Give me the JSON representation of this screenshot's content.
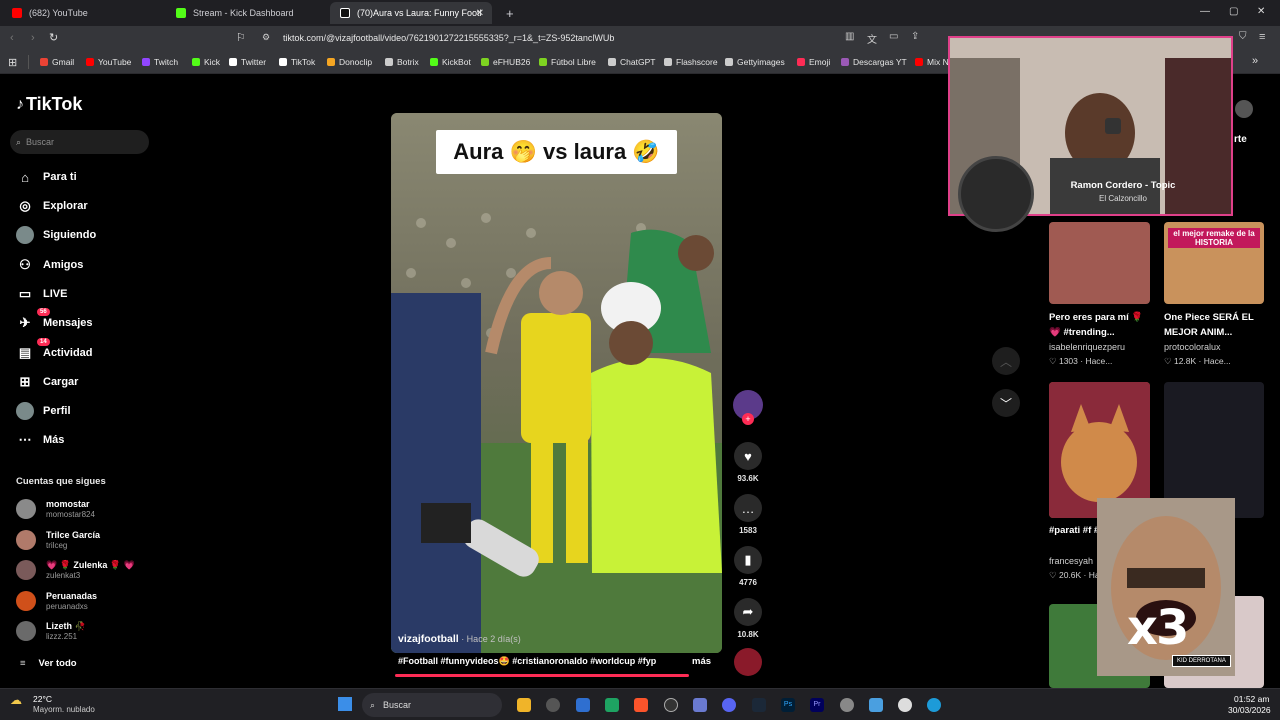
{
  "tabs": [
    {
      "label": "(682) YouTube",
      "color": "#ff0000"
    },
    {
      "label": "Stream - Kick Dashboard",
      "color": "#53fc18"
    },
    {
      "label": "(70)Aura vs Laura: Funny Footl",
      "color": "#ffffff"
    }
  ],
  "address": {
    "url": "tiktok.com/@vizajfootball/video/7621901272215555335?_r=1&_t=ZS-952tanclWUb"
  },
  "bookmarks": [
    {
      "label": "Gmail",
      "color": "#ea4335"
    },
    {
      "label": "YouTube",
      "color": "#ff0000"
    },
    {
      "label": "Twitch",
      "color": "#9146ff"
    },
    {
      "label": "Kick",
      "color": "#53fc18"
    },
    {
      "label": "Twitter",
      "color": "#ffffff"
    },
    {
      "label": "TikTok",
      "color": "#ffffff"
    },
    {
      "label": "Donoclip",
      "color": "#f5a623"
    },
    {
      "label": "Botrix",
      "color": "#cccccc"
    },
    {
      "label": "KickBot",
      "color": "#53fc18"
    },
    {
      "label": "eFHUB26",
      "color": "#7ed321"
    },
    {
      "label": "Fútbol Libre",
      "color": "#7ed321"
    },
    {
      "label": "ChatGPT",
      "color": "#cccccc"
    },
    {
      "label": "Flashscore",
      "color": "#cccccc"
    },
    {
      "label": "Gettyimages",
      "color": "#cccccc"
    },
    {
      "label": "Emoji",
      "color": "#fe2c55"
    },
    {
      "label": "Descargas YT",
      "color": "#9b59b6"
    },
    {
      "label": "Mix N",
      "color": "#ff0000"
    }
  ],
  "sidebar": {
    "logo": "TikTok",
    "search_placeholder": "Buscar",
    "nav": [
      {
        "label": "Para ti",
        "icon": "home-icon",
        "glyph": "⌂"
      },
      {
        "label": "Explorar",
        "icon": "compass-icon",
        "glyph": "◎"
      },
      {
        "label": "Siguiendo",
        "icon": "avatar-icon",
        "glyph": ""
      },
      {
        "label": "Amigos",
        "icon": "friends-icon",
        "glyph": "⚇"
      },
      {
        "label": "LIVE",
        "icon": "live-icon",
        "glyph": "▭"
      },
      {
        "label": "Mensajes",
        "icon": "messages-icon",
        "glyph": "✈",
        "badge": "56"
      },
      {
        "label": "Actividad",
        "icon": "activity-icon",
        "glyph": "▤",
        "badge": "14"
      },
      {
        "label": "Cargar",
        "icon": "upload-icon",
        "glyph": "⊞"
      },
      {
        "label": "Perfil",
        "icon": "profile-icon",
        "glyph": ""
      },
      {
        "label": "Más",
        "icon": "more-icon",
        "glyph": "⋯"
      }
    ],
    "following_title": "Cuentas que sigues",
    "accounts": [
      {
        "name": "momostar",
        "handle": "momostar824",
        "color": "#8a8a8a"
      },
      {
        "name": "Trilce García",
        "handle": "trilceg",
        "color": "#b07a6a"
      },
      {
        "name": "💗 🌹 Zulenka 🌹 💗",
        "handle": "zulenkat3",
        "color": "#7a5a5a"
      },
      {
        "name": "Peruanadas",
        "handle": "peruanadxs",
        "color": "#d0501a"
      },
      {
        "name": "Lizeth 🥀",
        "handle": "lizzz.251",
        "color": "#6a6a6a"
      }
    ],
    "see_all": "Ver todo"
  },
  "video": {
    "overlay_text": "Aura 🤭 vs laura 🤣",
    "author": "vizajfootball",
    "time": " · Hace 2 día(s)",
    "tags": "#Football #funnyvideos🤩 #cristianoronaldo #worldcup #fyp",
    "more": "más"
  },
  "actions": {
    "likes": "93.6K",
    "comments": "1583",
    "saves": "4776",
    "shares": "10.8K"
  },
  "right_panel": {
    "header_partial": "rte",
    "cards": [
      {
        "title": "Pero eres para mí 🌹 💗 #trending...",
        "user": "isabelenriquezperu",
        "stat": "♡ 1303 · Hace...",
        "color": "#a05a52"
      },
      {
        "title": "One Piece SERÁ EL MEJOR ANIM...",
        "user": "protocoloralux",
        "stat": "♡ 12.8K · Hace...",
        "color": "#c9925c",
        "banner": "el mejor remake de la HISTORIA"
      },
      {
        "title": "#parati #f #foryou...",
        "user": "francesyah",
        "stat": "♡ 20.6K · Ha",
        "color": "#b56a3a"
      },
      {
        "title": "",
        "user": "",
        "stat": "",
        "color": "#3a3a44"
      }
    ]
  },
  "overlay": {
    "music_title": "Ramon Cordero - Topic",
    "music_sub": "El Calzoncillo",
    "meme_text": "x3",
    "meme_label": "KID DERROTANA"
  },
  "taskbar": {
    "weather_temp": "22°C",
    "weather_desc": "Mayorm. nublado",
    "search": "Buscar",
    "time": "01:52 am",
    "date": "30/03/2026"
  }
}
